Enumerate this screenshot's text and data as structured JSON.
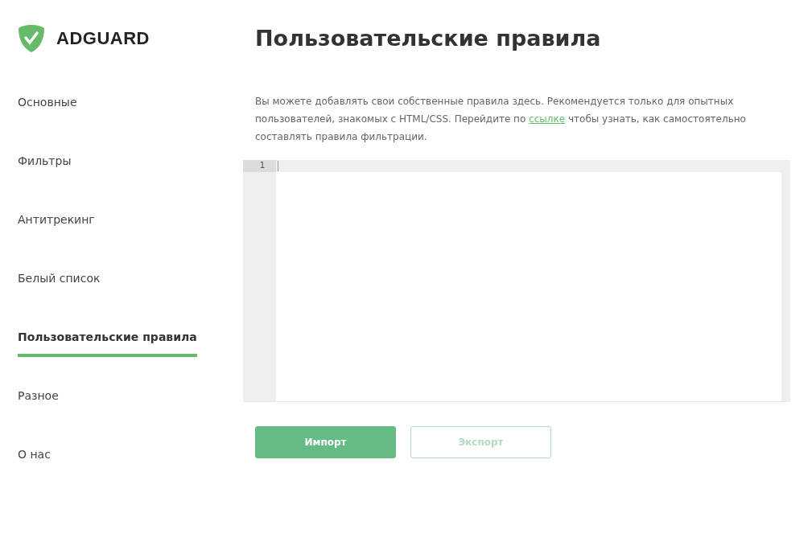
{
  "logo": {
    "text": "ADGUARD"
  },
  "sidebar": {
    "items": [
      {
        "label": "Основные",
        "selected": false
      },
      {
        "label": "Фильтры",
        "selected": false
      },
      {
        "label": "Антитрекинг",
        "selected": false
      },
      {
        "label": "Белый список",
        "selected": false
      },
      {
        "label": "Пользовательские правила",
        "selected": true
      },
      {
        "label": "Разное",
        "selected": false
      },
      {
        "label": "О нас",
        "selected": false
      }
    ]
  },
  "page": {
    "title": "Пользовательские правила",
    "description": {
      "before": "Вы можете добавлять свои собственные правила здесь. Рекомендуется только для опытных пользователей, знакомых с HTML/CSS. Перейдите по",
      "link": "ссылке",
      "after": "чтобы узнать, как самостоятельно составлять правила фильтрации."
    },
    "editor": {
      "lines": [
        {
          "number": "1"
        }
      ]
    },
    "buttons": [
      {
        "label": "Импорт",
        "kind": "primary",
        "disabled": false
      },
      {
        "label": "Экспорт",
        "kind": "outline",
        "disabled": true
      }
    ]
  }
}
